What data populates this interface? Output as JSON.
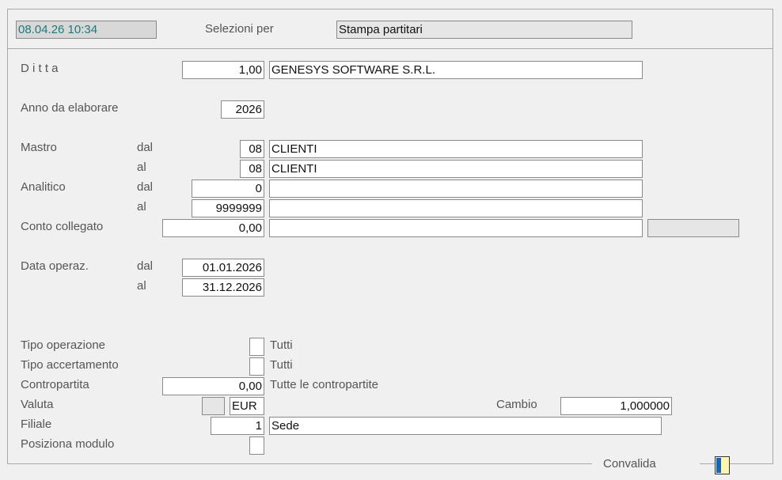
{
  "header": {
    "datetime": "08.04.26 10:34",
    "selections_label": "Selezioni per",
    "selections_value": "Stampa partitari"
  },
  "ditta": {
    "label": "D i t t a",
    "code": "1,00",
    "name": "GENESYS SOFTWARE S.R.L."
  },
  "anno": {
    "label": "Anno da elaborare",
    "value": "2026"
  },
  "mastro": {
    "label": "Mastro",
    "from_label": "dal",
    "to_label": "al",
    "from_code": "08",
    "from_desc": "CLIENTI",
    "to_code": "08",
    "to_desc": "CLIENTI"
  },
  "analitico": {
    "label": "Analitico",
    "from_label": "dal",
    "to_label": "al",
    "from_value": "0",
    "from_desc": "",
    "to_value": "9999999",
    "to_desc": ""
  },
  "conto_collegato": {
    "label": "Conto collegato",
    "value": "0,00",
    "desc": "",
    "extra": ""
  },
  "data_operaz": {
    "label": "Data operaz.",
    "from_label": "dal",
    "to_label": "al",
    "from_value": "01.01.2026",
    "to_value": "31.12.2026"
  },
  "tipo_operazione": {
    "label": "Tipo operazione",
    "value": "",
    "desc": "Tutti"
  },
  "tipo_accertamento": {
    "label": "Tipo accertamento",
    "value": "",
    "desc": "Tutti"
  },
  "contropartita": {
    "label": "Contropartita",
    "value": "0,00",
    "desc": "Tutte le contropartite"
  },
  "valuta": {
    "label": "Valuta",
    "flag": "",
    "code": "EUR"
  },
  "cambio": {
    "label": "Cambio",
    "value": "1,000000"
  },
  "filiale": {
    "label": "Filiale",
    "code": "1",
    "desc": "Sede"
  },
  "posiziona_modulo": {
    "label": "Posiziona modulo",
    "value": ""
  },
  "footer": {
    "convalida_label": "Convalida"
  },
  "colors": {
    "datetime_text": "#1d7a7a",
    "datetime_bg": "#d8d8d8",
    "border": "#a8a8a8",
    "convalida_blue": "#1565c0",
    "convalida_yellow": "#fff7b0"
  }
}
